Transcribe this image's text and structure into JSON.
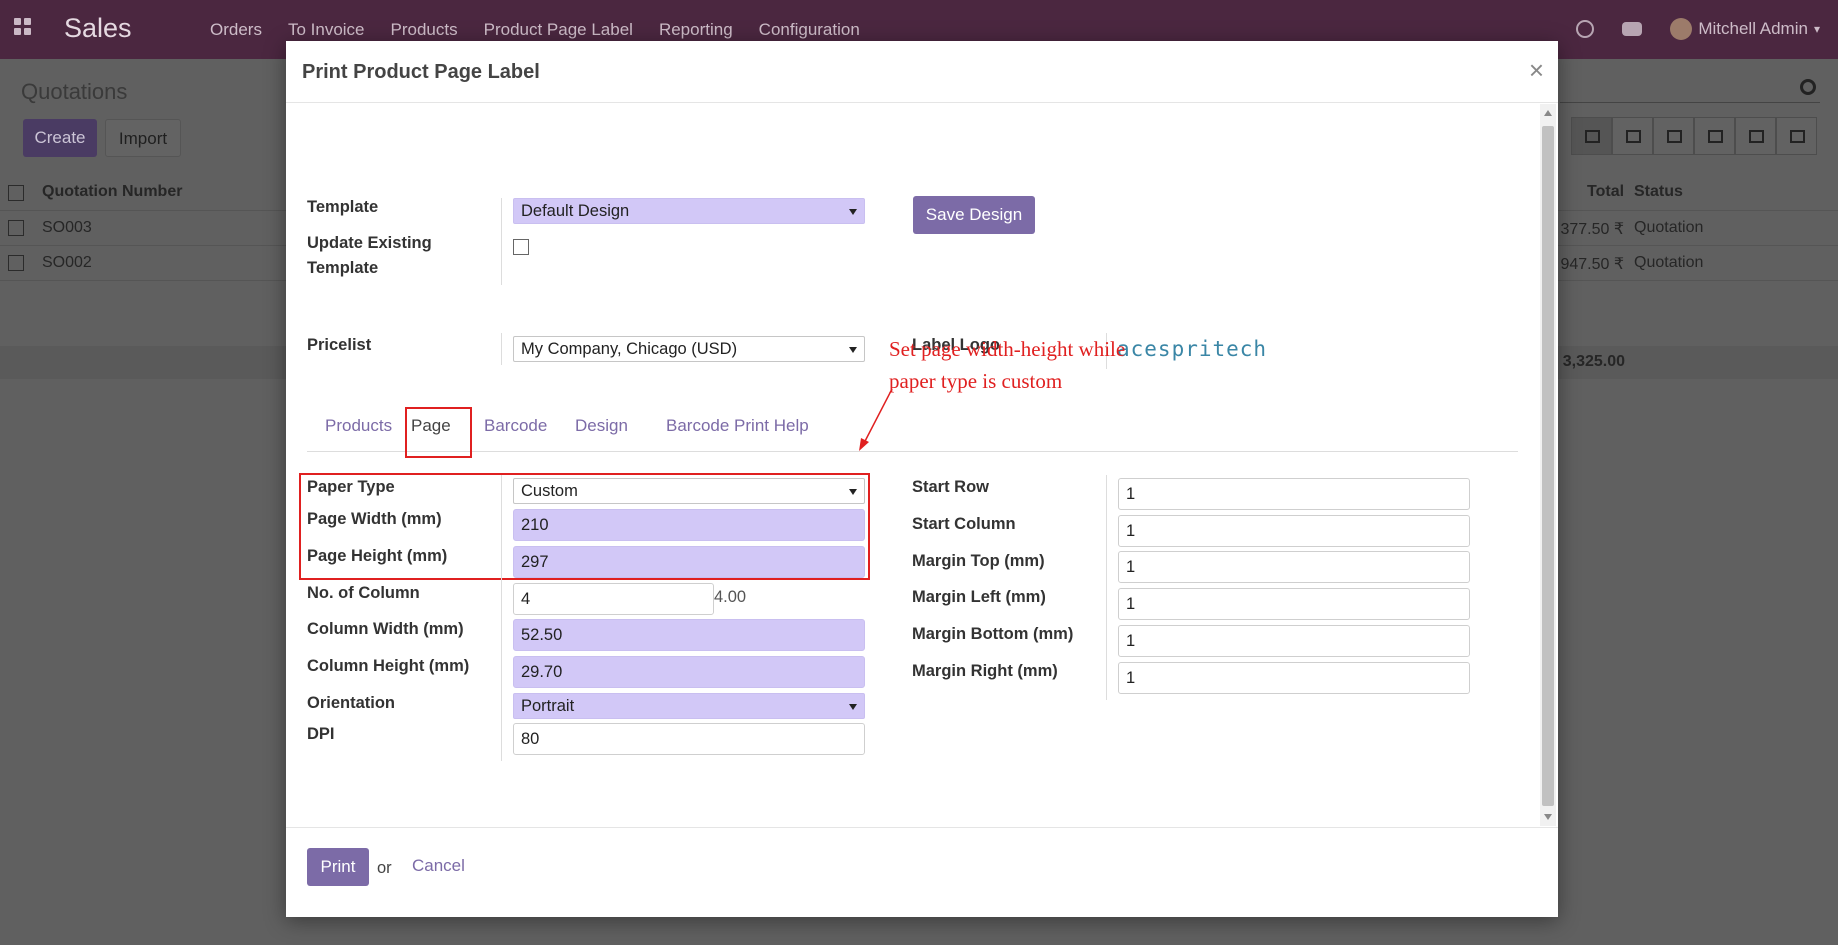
{
  "navbar": {
    "brand": "Sales",
    "menu": [
      "Orders",
      "To Invoice",
      "Products",
      "Product Page Label",
      "Reporting",
      "Configuration"
    ],
    "user": "Mitchell Admin"
  },
  "background": {
    "title": "Quotations",
    "create_label": "Create",
    "import_label": "Import",
    "columns": {
      "number": "Quotation Number",
      "total": "Total",
      "status": "Status"
    },
    "rows": [
      {
        "number": "SO003",
        "amount": "377.50 ₹",
        "status": "Quotation"
      },
      {
        "number": "SO002",
        "amount": "947.50 ₹",
        "status": "Quotation"
      }
    ],
    "grand_total": "3,325.00"
  },
  "modal": {
    "title": "Print Product Page Label",
    "close": "×",
    "template_label": "Template",
    "template_value": "Default Design",
    "save_design_label": "Save Design",
    "update_existing_label_1": "Update Existing",
    "update_existing_label_2": "Template",
    "pricelist_label": "Pricelist",
    "pricelist_value": "My Company, Chicago (USD)",
    "label_logo_label": "Label Logo",
    "logo_text": "acespritech",
    "tabs": [
      "Products",
      "Page",
      "Barcode",
      "Design",
      "Barcode Print Help"
    ],
    "annotation_line1": "Set page width-height while",
    "annotation_line2": "paper type is custom",
    "left_fields": {
      "paper_type_label": "Paper Type",
      "paper_type_value": "Custom",
      "page_width_label": "Page Width (mm)",
      "page_width_value": "210",
      "page_height_label": "Page Height (mm)",
      "page_height_value": "297",
      "no_column_label": "No. of Column",
      "no_column_value": "4",
      "no_column_extra": "4.00",
      "column_width_label": "Column Width (mm)",
      "column_width_value": "52.50",
      "column_height_label": "Column Height (mm)",
      "column_height_value": "29.70",
      "orientation_label": "Orientation",
      "orientation_value": "Portrait",
      "dpi_label": "DPI",
      "dpi_value": "80"
    },
    "right_fields": {
      "start_row_label": "Start Row",
      "start_row_value": "1",
      "start_column_label": "Start Column",
      "start_column_value": "1",
      "margin_top_label": "Margin Top (mm)",
      "margin_top_value": "1",
      "margin_left_label": "Margin Left (mm)",
      "margin_left_value": "1",
      "margin_bottom_label": "Margin Bottom (mm)",
      "margin_bottom_value": "1",
      "margin_right_label": "Margin Right (mm)",
      "margin_right_value": "1"
    },
    "footer": {
      "print_label": "Print",
      "or_label": "or",
      "cancel_label": "Cancel"
    }
  },
  "colors": {
    "navbar": "#4b2740",
    "primary": "#7c6ba7",
    "required_field": "#d2c8f7",
    "annotation": "#e02020"
  }
}
